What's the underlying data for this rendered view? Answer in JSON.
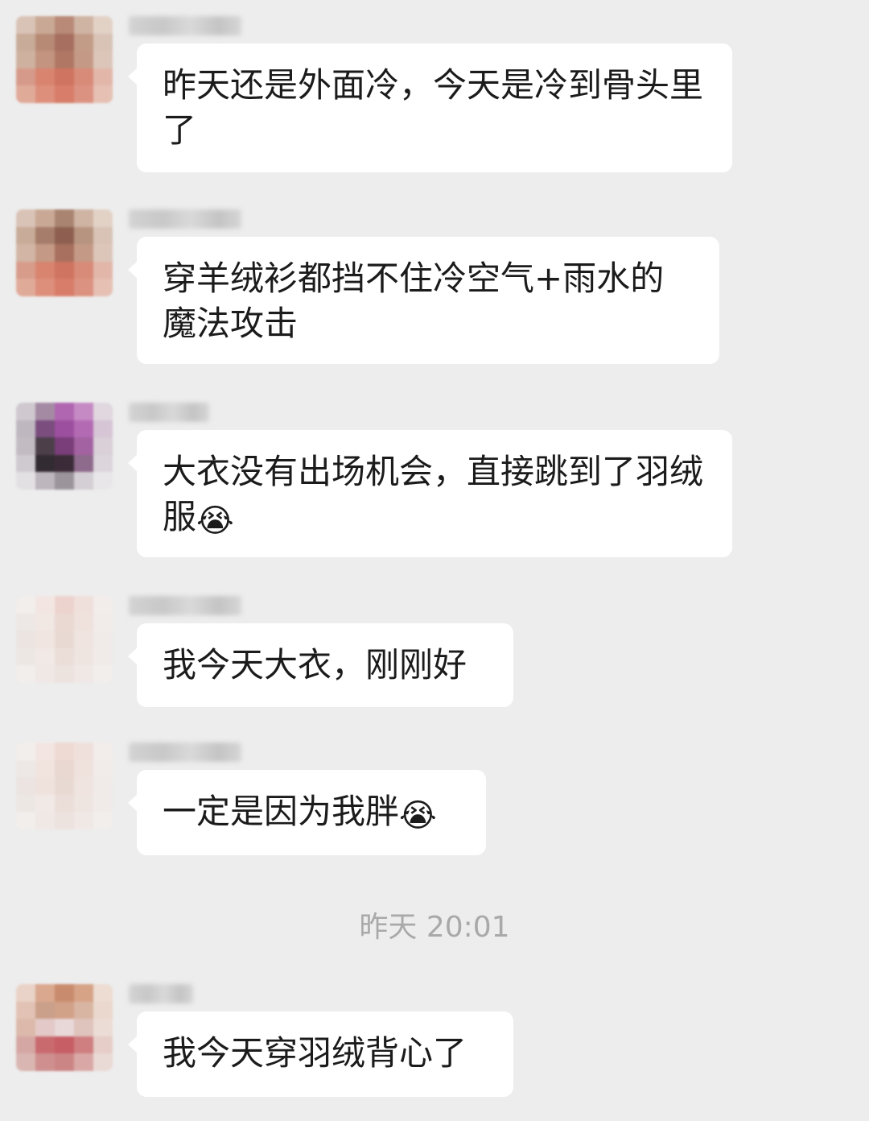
{
  "chat": {
    "messages": [
      {
        "text": "昨天还是外面冷，今天是冷到骨头里了",
        "emoji": "",
        "emoji_icon": "",
        "avatar_colors": [
          "#d9c2b6",
          "#c9a995",
          "#b98a78",
          "#cfb4a4",
          "#e2d2c6",
          "#c8ab98",
          "#b78a76",
          "#a66f5f",
          "#c39c88",
          "#d8c3b6",
          "#cfb1a0",
          "#c39480",
          "#b07864",
          "#c49a86",
          "#dcc6ba",
          "#d69a8a",
          "#d8846f",
          "#cf7460",
          "#d88b78",
          "#e2b7aa",
          "#e0aa99",
          "#dd8f7c",
          "#d77d69",
          "#dc9281",
          "#e5c0b3"
        ]
      },
      {
        "text": "穿羊绒衫都挡不住冷空气+雨水的魔法攻击",
        "emoji": "",
        "emoji_icon": "",
        "avatar_colors": [
          "#d9c2b6",
          "#c9a995",
          "#a98471",
          "#cfb4a4",
          "#e2d2c6",
          "#c8ab98",
          "#a67d6a",
          "#8e5f50",
          "#b79480",
          "#d8c3b6",
          "#d2b5a5",
          "#c49a86",
          "#a8705e",
          "#c49a86",
          "#dcc6ba",
          "#d89c8b",
          "#d8846f",
          "#cf7460",
          "#d88b78",
          "#e2b7aa",
          "#e0aa99",
          "#dd8f7c",
          "#d77d69",
          "#dc9281",
          "#e5c0b3"
        ]
      },
      {
        "text": "大衣没有出场机会，直接跳到了羽绒服",
        "emoji": "😭",
        "emoji_icon": "face-crying-with-hand-icon",
        "avatar_colors": [
          "#cfc8cf",
          "#a58aa4",
          "#b066b0",
          "#c58ac4",
          "#e0d7df",
          "#bfb7c0",
          "#7a4d7e",
          "#9c4f9f",
          "#b36ab3",
          "#d6c5d5",
          "#c2bcc2",
          "#4c3f4a",
          "#7a3e7a",
          "#a362a1",
          "#d9d0d8",
          "#cfcacf",
          "#332b32",
          "#3b2b38",
          "#8e6a8c",
          "#dcd6dc",
          "#e3e0e3",
          "#bdb6bd",
          "#9b959b",
          "#d4cfd4",
          "#e8e6e8"
        ]
      },
      {
        "text": "我今天大衣，刚刚好",
        "emoji": "",
        "emoji_icon": "",
        "avatar_colors": [
          "#f2eeec",
          "#f3e6e2",
          "#ecd3ce",
          "#f0e0dc",
          "#f2ecea",
          "#ede8e6",
          "#f1e7e3",
          "#ead9d3",
          "#efe2dd",
          "#f1ecea",
          "#ebe4e1",
          "#f0e5e1",
          "#e9d9d3",
          "#efe4e0",
          "#f0ebe9",
          "#ede7e4",
          "#f1e9e6",
          "#ebded9",
          "#eee5e1",
          "#f0ebe9",
          "#f1eeec",
          "#efe8e5",
          "#ece2de",
          "#efe8e5",
          "#f1eeec"
        ]
      },
      {
        "text": "一定是因为我胖",
        "emoji": "😭",
        "emoji_icon": "face-crying-with-hand-icon",
        "avatar_colors": [
          "#f2eeec",
          "#f3e6e2",
          "#efd9d3",
          "#f0e0dc",
          "#f2ecea",
          "#ede8e6",
          "#f1e4df",
          "#e9d7d1",
          "#efe2dd",
          "#f1ecea",
          "#ebe4e1",
          "#efe2dd",
          "#e9d9d3",
          "#efe4e0",
          "#f0ebe9",
          "#ede7e4",
          "#f1e9e6",
          "#ebded9",
          "#eee5e1",
          "#f0ebe9",
          "#f1eeec",
          "#efe8e5",
          "#ece2de",
          "#efe8e5",
          "#f1eeec"
        ]
      },
      {
        "text": "我今天穿羽绒背心了",
        "emoji": "",
        "emoji_icon": "",
        "avatar_colors": [
          "#e9d2c7",
          "#d9a88f",
          "#c98b6d",
          "#d6a387",
          "#ecdcd2",
          "#e1c2b4",
          "#caa08a",
          "#d1a188",
          "#d8b5a2",
          "#ead8ce",
          "#dcb9aa",
          "#e3c9c7",
          "#e8d8d8",
          "#dfc3bd",
          "#ebdcd5",
          "#d5a7a4",
          "#c96a6f",
          "#c75e65",
          "#cf7f80",
          "#e6cdc8",
          "#d9b6b1",
          "#cf8f8f",
          "#cc8585",
          "#d9a8a6",
          "#eadad5"
        ]
      }
    ],
    "timestamp": "昨天 20:01"
  }
}
